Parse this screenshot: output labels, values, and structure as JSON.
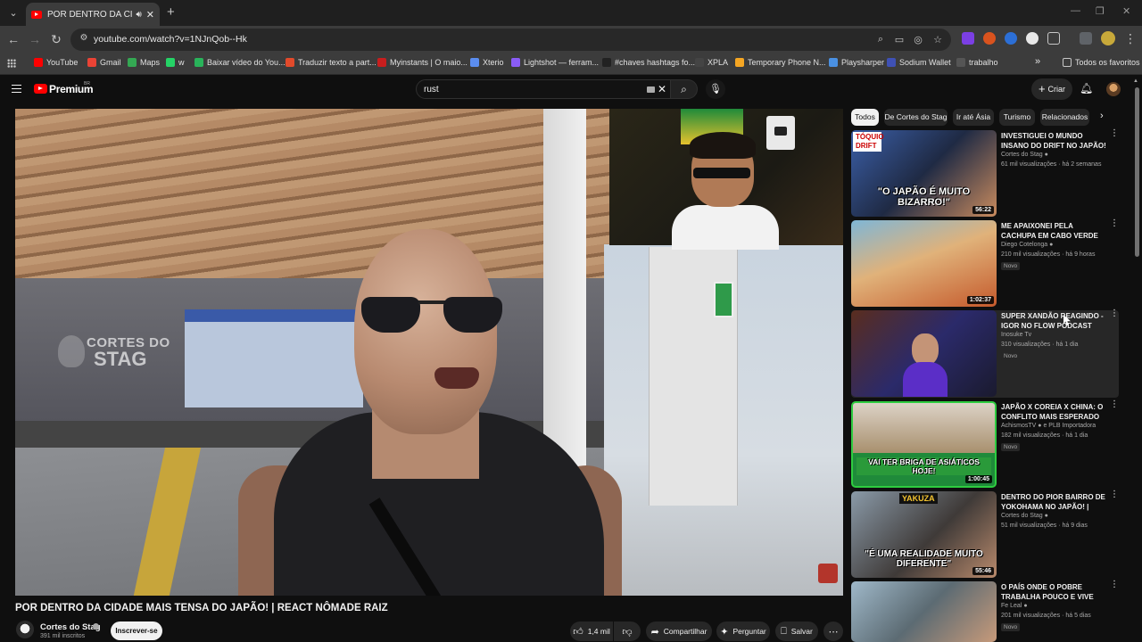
{
  "browser": {
    "tab_title": "POR DENTRO DA CIDADE M",
    "url": "youtube.com/watch?v=1NJnQob--Hk",
    "bookmarks": [
      {
        "label": "YouTube",
        "color": "#ff0000"
      },
      {
        "label": "Gmail",
        "color": "#ea4335"
      },
      {
        "label": "Maps",
        "color": "#34a853"
      },
      {
        "label": "w",
        "color": "#25d366"
      },
      {
        "label": "Baixar vídeo do You...",
        "color": "#29b35a"
      },
      {
        "label": "Traduzir texto a part...",
        "color": "#e24a2b"
      },
      {
        "label": "Myinstants | O maio...",
        "color": "#c81e1e"
      },
      {
        "label": "Xterio",
        "color": "#5b8def"
      },
      {
        "label": "Lightshot — ferram...",
        "color": "#8a5cf6"
      },
      {
        "label": "#chaves hashtags fo...",
        "color": "#222222"
      },
      {
        "label": "XPLA",
        "color": "#444444"
      },
      {
        "label": "Temporary Phone N...",
        "color": "#f5a623"
      },
      {
        "label": "Playsharper",
        "color": "#4a90e2"
      },
      {
        "label": "Sodium Wallet",
        "color": "#3f51b5"
      },
      {
        "label": "trabalho",
        "color": "#555555"
      }
    ],
    "all_bookmarks": "Todos os favoritos",
    "more_bookmarks": "»"
  },
  "masthead": {
    "brand": "Premium",
    "country": "BR",
    "search_query": "rust",
    "create_label": "Criar"
  },
  "video": {
    "title": "POR DENTRO DA CIDADE MAIS TENSA DO JAPÃO! | REACT NÔMADE RAIZ",
    "watermark_top": "CORTES DO",
    "watermark_bottom": "STAG",
    "channel": "Cortes do Stag",
    "subscribers": "391 mil inscritos",
    "subscribe_label": "Inscrever-se",
    "likes": "1,4 mil",
    "share_label": "Compartilhar",
    "ask_label": "Perguntar",
    "save_label": "Salvar"
  },
  "chips": [
    "Todos",
    "De Cortes do Stag",
    "Ir até Ásia",
    "Turismo",
    "Relacionados"
  ],
  "recommendations": [
    {
      "title": "INVESTIGUEI O MUNDO INSANO DO DRIFT NO JAPÃO! | REACT ...",
      "channel": "Cortes do Stag",
      "meta": "61 mil visualizações · há 2 semanas",
      "duration": "56:22",
      "badge": "",
      "caption": "\"O JAPÃO É MUITO BIZARRO!\"",
      "tag": "TÓQUIO DRIFT"
    },
    {
      "title": "ME APAIXONEI PELA CACHUPA EM CABO VERDE",
      "channel": "Diego Cotelonga",
      "meta": "210 mil visualizações · há 9 horas",
      "duration": "1:02:37",
      "badge": "Novo",
      "caption": "",
      "tag": ""
    },
    {
      "title": "SUPER XANDÃO REAGINDO - IGOR NO FLOW PODCAST FALANDO ...",
      "channel": "Inosuke Tv",
      "meta": "310 visualizações · há 1 dia",
      "duration": "",
      "badge": "Novo",
      "caption": "",
      "tag": ""
    },
    {
      "title": "JAPÃO X COREIA X CHINA: O CONFLITO MAIS ESPERADO DO ...",
      "channel": "AchismosTV",
      "meta": "182 mil visualizações · há 1 dia",
      "duration": "1:00:45",
      "badge": "Novo",
      "caption": "VAI TER BRIGA DE ASIÁTICOS HOJE!",
      "tag": "",
      "channel_extra": "e PLB Importadora"
    },
    {
      "title": "DENTRO DO PIOR BAIRRO DE YOKOHAMA NO JAPÃO! | REACT ...",
      "channel": "Cortes do Stag",
      "meta": "51 mil visualizações · há 9 dias",
      "duration": "55:46",
      "badge": "",
      "caption": "\"É UMA REALIDADE MUITO DIFERENTE\"",
      "tag": "YAKUZA"
    },
    {
      "title": "O PAÍS ONDE O POBRE TRABALHA POUCO E VIVE COMO RICO",
      "channel": "Fe Leal",
      "meta": "201 mil visualizações · há 5 dias",
      "duration": "",
      "badge": "Novo",
      "caption": "",
      "tag": ""
    }
  ]
}
